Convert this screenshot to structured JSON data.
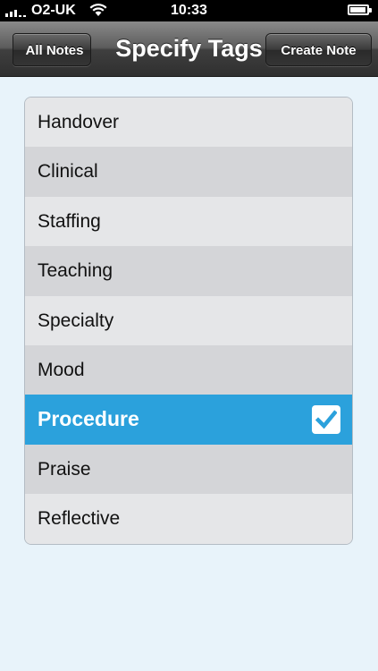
{
  "status_bar": {
    "carrier": "O2-UK",
    "time": "10:33",
    "signal_bars": 3,
    "battery_level": 0.85
  },
  "nav": {
    "title": "Specify Tags",
    "back_label": "All Notes",
    "right_label": "Create Note"
  },
  "tags": [
    {
      "label": "Handover",
      "selected": false
    },
    {
      "label": "Clinical",
      "selected": false
    },
    {
      "label": "Staffing",
      "selected": false
    },
    {
      "label": "Teaching",
      "selected": false
    },
    {
      "label": "Specialty",
      "selected": false
    },
    {
      "label": "Mood",
      "selected": false
    },
    {
      "label": "Procedure",
      "selected": true
    },
    {
      "label": "Praise",
      "selected": false
    },
    {
      "label": "Reflective",
      "selected": false
    }
  ],
  "colors": {
    "selected_row": "#2ba1dc",
    "background": "#e8f3fa"
  },
  "icons": {
    "check": "checkmark-icon",
    "wifi": "wifi-icon",
    "battery": "battery-charging-icon"
  }
}
